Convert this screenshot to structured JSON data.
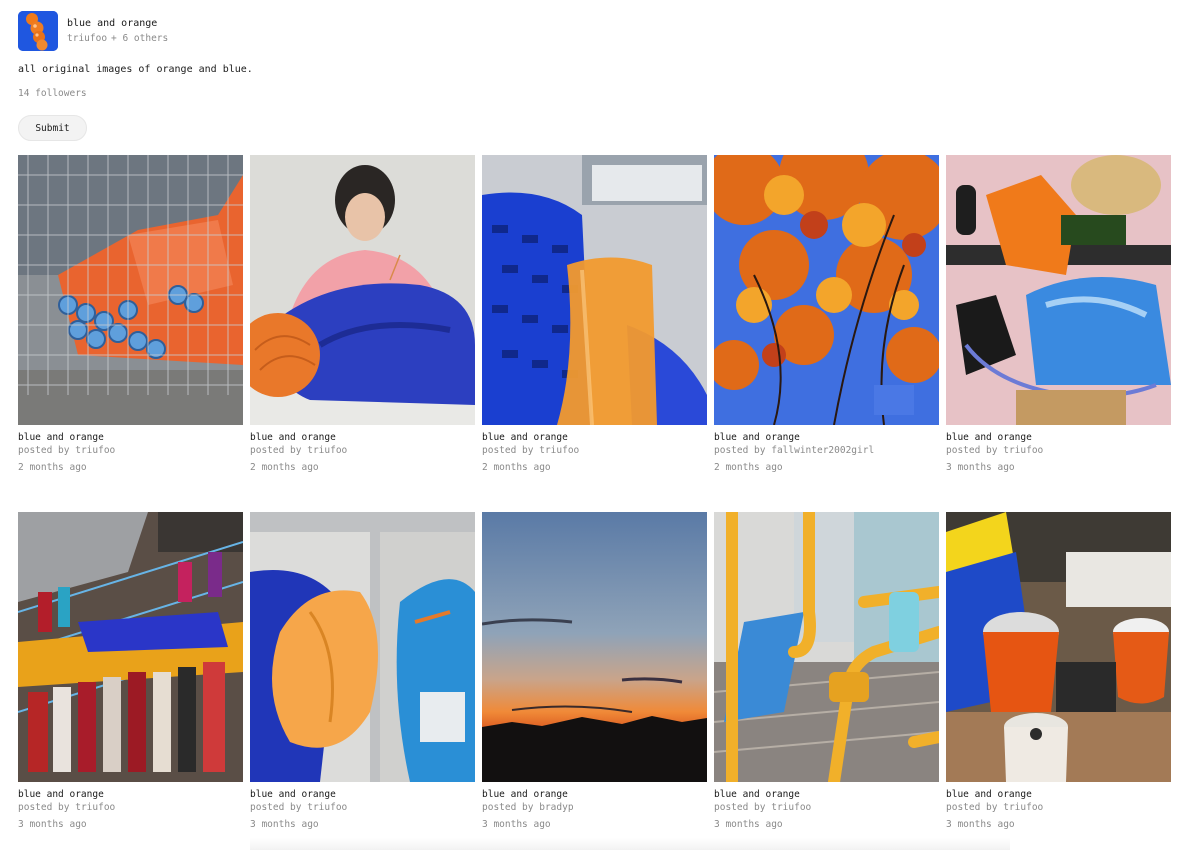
{
  "group": {
    "title": "blue and orange",
    "owner": "triufoo",
    "others": "+ 6 others",
    "description": "all original images of orange and blue.",
    "followers": "14 followers",
    "submit_label": "Submit"
  },
  "colors": {
    "accent_blue": "#1f57e0",
    "accent_orange": "#f07a1a"
  },
  "posts": [
    {
      "title": "blue and orange",
      "posted_by": "posted by",
      "user": "triufoo",
      "time": "2 months ago"
    },
    {
      "title": "blue and orange",
      "posted_by": "posted by",
      "user": "triufoo",
      "time": "2 months ago"
    },
    {
      "title": "blue and orange",
      "posted_by": "posted by",
      "user": "triufoo",
      "time": "2 months ago"
    },
    {
      "title": "blue and orange",
      "posted_by": "posted by",
      "user": "fallwinter2002girl",
      "time": "2 months ago"
    },
    {
      "title": "blue and orange",
      "posted_by": "posted by",
      "user": "triufoo",
      "time": "3 months ago"
    },
    {
      "title": "blue and orange",
      "posted_by": "posted by",
      "user": "triufoo",
      "time": "3 months ago"
    },
    {
      "title": "blue and orange",
      "posted_by": "posted by",
      "user": "triufoo",
      "time": "3 months ago"
    },
    {
      "title": "blue and orange",
      "posted_by": "posted by",
      "user": "bradyp",
      "time": "3 months ago"
    },
    {
      "title": "blue and orange",
      "posted_by": "posted by",
      "user": "triufoo",
      "time": "3 months ago"
    },
    {
      "title": "blue and orange",
      "posted_by": "posted by",
      "user": "triufoo",
      "time": "3 months ago"
    }
  ]
}
